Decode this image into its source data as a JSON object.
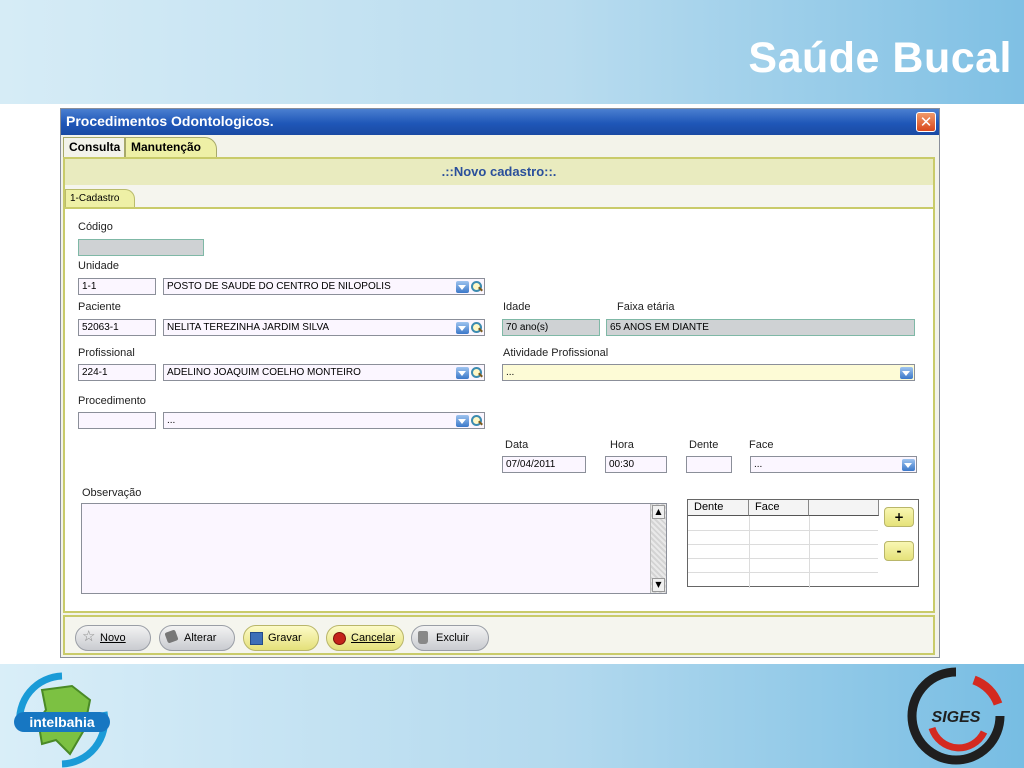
{
  "slide": {
    "title": "Saúde Bucal",
    "logo_left": "intelbahia",
    "logo_right": "SIGES"
  },
  "window": {
    "title": "Procedimentos Odontologicos.",
    "close_icon": "close-icon"
  },
  "tabs": {
    "consulta": "Consulta",
    "manutencao": "Manutenção"
  },
  "panel": {
    "header": ".::Novo cadastro::.",
    "subtab": "1-Cadastro"
  },
  "form": {
    "codigo_label": "Código",
    "codigo_value": "",
    "unidade_label": "Unidade",
    "unidade_code": "1-1",
    "unidade_name": "POSTO DE SAUDE DO CENTRO DE NILOPOLIS",
    "paciente_label": "Paciente",
    "paciente_code": "52063-1",
    "paciente_name": "NELITA TEREZINHA JARDIM SILVA",
    "idade_label": "Idade",
    "idade_value": "70 ano(s)",
    "faixa_label": "Faixa etária",
    "faixa_value": "65 ANOS EM DIANTE",
    "profissional_label": "Profissional",
    "profissional_code": "224-1",
    "profissional_name": "ADELINO JOAQUIM COELHO MONTEIRO",
    "atividade_label": "Atividade Profissional",
    "atividade_value": "...",
    "procedimento_label": "Procedimento",
    "procedimento_code": "",
    "procedimento_name": "...",
    "data_label": "Data",
    "data_value": "07/04/2011",
    "hora_label": "Hora",
    "hora_value": "00:30",
    "dente_label": "Dente",
    "dente_value": "",
    "face_label": "Face",
    "face_value": "...",
    "observacao_label": "Observação",
    "observacao_value": ""
  },
  "grid": {
    "columns": [
      "Dente",
      "Face"
    ],
    "add_label": "+",
    "remove_label": "-"
  },
  "toolbar": {
    "novo": "Novo",
    "alterar": "Alterar",
    "gravar": "Gravar",
    "cancelar": "Cancelar",
    "excluir": "Excluir"
  }
}
